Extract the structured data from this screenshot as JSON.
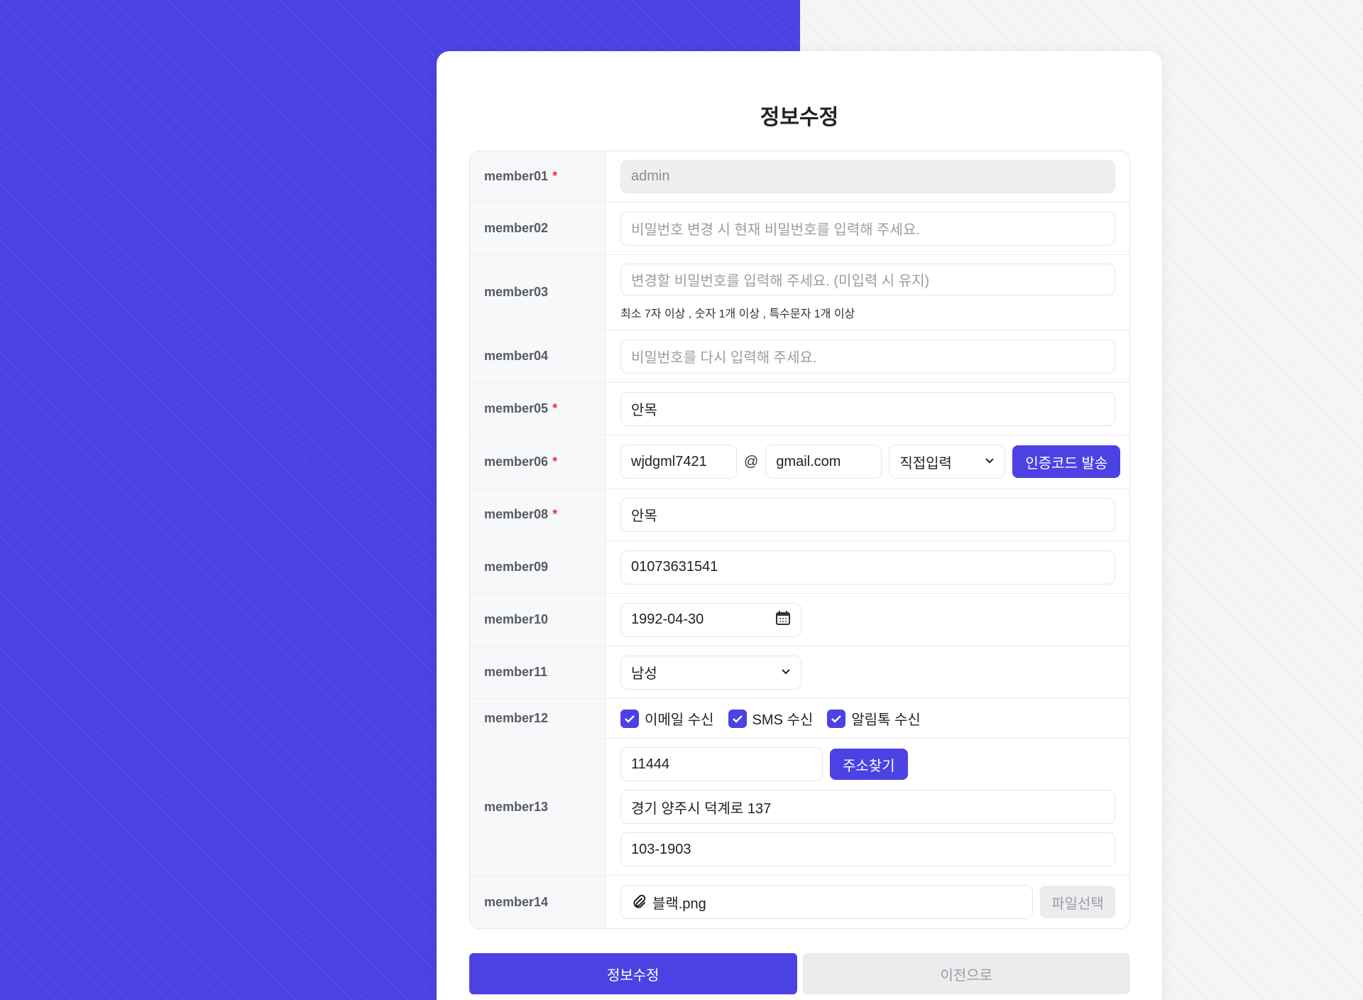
{
  "page": {
    "title": "정보수정"
  },
  "colors": {
    "accent": "#4c42e4",
    "required": "#e53935"
  },
  "rows": {
    "r1": {
      "label": "member01",
      "required_mark": "*",
      "value": "admin"
    },
    "r2": {
      "label": "member02",
      "placeholder": "비밀번호 변경 시 현재 비밀번호를 입력해 주세요."
    },
    "r3": {
      "label": "member03",
      "placeholder": "변경할 비밀번호를 입력해 주세요. (미입력 시 유지)",
      "hint": "최소 7자 이상 , 숫자 1개 이상 , 특수문자 1개 이상"
    },
    "r4": {
      "label": "member04",
      "placeholder": "비밀번호를 다시 입력해 주세요."
    },
    "r5": {
      "label": "member05",
      "required_mark": "*",
      "value": "안목"
    },
    "r6": {
      "label": "member06",
      "required_mark": "*",
      "email_id": "wjdgml7421",
      "at": "@",
      "email_domain": "gmail.com",
      "domain_select": "직접입력",
      "send_code_label": "인증코드 발송"
    },
    "r8": {
      "label": "member08",
      "required_mark": "*",
      "value": "안목"
    },
    "r9": {
      "label": "member09",
      "value": "01073631541"
    },
    "r10": {
      "label": "member10",
      "value": "1992-04-30"
    },
    "r11": {
      "label": "member11",
      "value": "남성"
    },
    "r12": {
      "label": "member12",
      "options": [
        "이메일 수신",
        "SMS 수신",
        "알림톡 수신"
      ]
    },
    "r13": {
      "label": "member13",
      "zip": "11444",
      "find_label": "주소찾기",
      "addr1": "경기 양주시 덕계로 137",
      "addr2": "103-1903"
    },
    "r14": {
      "label": "member14",
      "file_name": "블랙.png",
      "choose_label": "파일선택"
    }
  },
  "buttons": {
    "submit": "정보수정",
    "back": "이전으로"
  }
}
